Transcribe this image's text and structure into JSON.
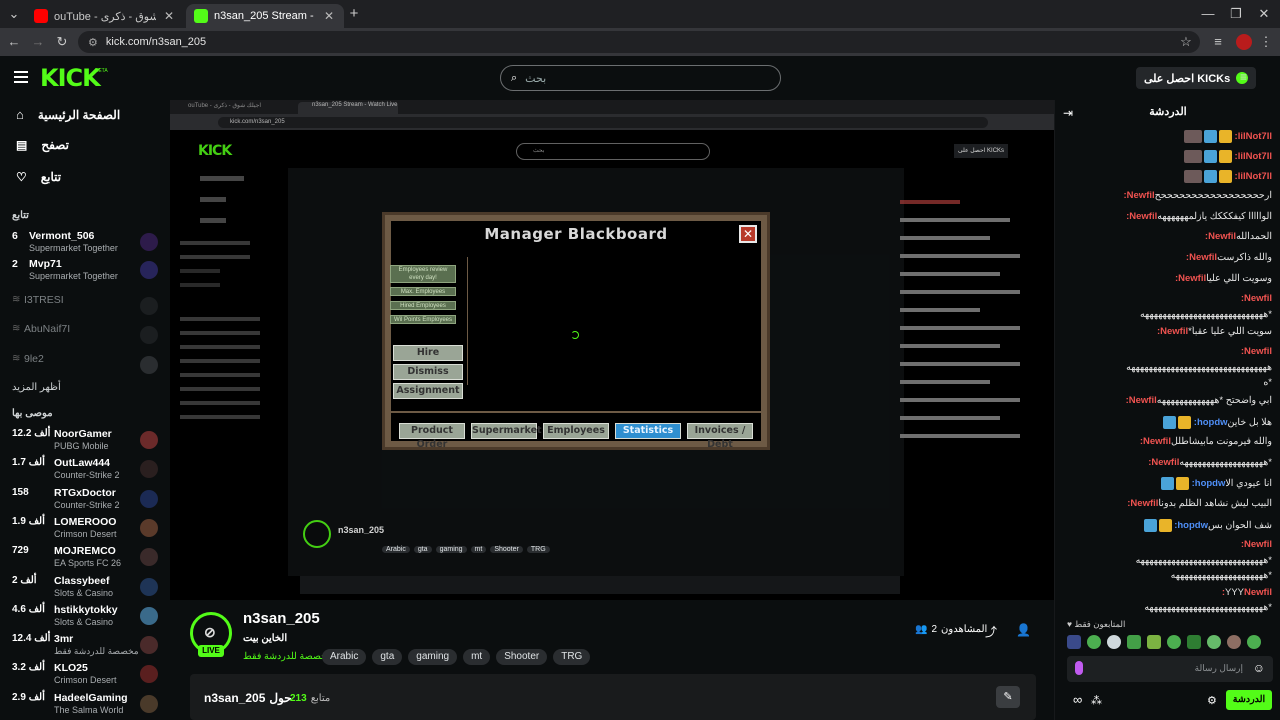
{
  "browser": {
    "tabs": [
      {
        "title": "(ذكرى - اجيلك شوق - YouTube",
        "short": "ouTube - اجيلك شوق - ذكرى"
      },
      {
        "title": "n3san_205 Stream - Watch Live"
      }
    ],
    "url": "kick.com/n3san_205",
    "new_tab": "+"
  },
  "header": {
    "logo": "KICK",
    "logo_beta": "BETA",
    "search_placeholder": "بحث",
    "get_kicks": "احصل على KICKs"
  },
  "sidebar": {
    "nav": [
      {
        "label": "الصفحة الرئيسية",
        "icon": "home-icon"
      },
      {
        "label": "تصفح",
        "icon": "browse-icon"
      },
      {
        "label": "تتابع",
        "icon": "heart-icon"
      }
    ],
    "following_title": "تتابع",
    "following": [
      {
        "count": "6",
        "name": "Vermont_506",
        "sub": "Supermarket Together",
        "live": true
      },
      {
        "count": "2",
        "name": "Mvp71",
        "sub": "Supermarket Together",
        "live": true
      },
      {
        "name": "I3TRESI",
        "live": false
      },
      {
        "name": "AbuNaif7I",
        "live": false
      },
      {
        "name": "9le2",
        "live": false
      }
    ],
    "show_more": "أظهر المزيد",
    "recommended_title": "موصى بها",
    "recommended": [
      {
        "count": "12.2 ألف",
        "name": "NoorGamer",
        "sub": "PUBG Mobile"
      },
      {
        "count": "1.7 ألف",
        "name": "OutLaw444",
        "sub": "Counter-Strike 2"
      },
      {
        "count": "158",
        "name": "RTGxDoctor",
        "sub": "Counter-Strike 2"
      },
      {
        "count": "1.9 ألف",
        "name": "LOMEROOO",
        "sub": "Crimson Desert"
      },
      {
        "count": "729",
        "name": "MOJREMCO",
        "sub": "EA Sports FC 26"
      },
      {
        "count": "2 ألف",
        "name": "Classybeef",
        "sub": "Slots & Casino"
      },
      {
        "count": "4.6 ألف",
        "name": "hstikkytokky",
        "sub": "Slots & Casino"
      },
      {
        "count": "12.4 ألف",
        "name": "3mr",
        "sub": "مخصصة للدردشة فقط"
      },
      {
        "count": "3.2 ألف",
        "name": "KLO25",
        "sub": "Crimson Desert"
      },
      {
        "count": "2.9 ألف",
        "name": "HadeelGaming",
        "sub": "The Salma World"
      }
    ]
  },
  "game": {
    "title": "Manager Blackboard",
    "side_buttons": [
      "Employees review every day!",
      "Max. Employees",
      "Hired Employees",
      "Wil Points Employees"
    ],
    "actions": [
      "Hire",
      "Dismiss",
      "Assignment"
    ],
    "tabs": [
      "Product Order",
      "Supermarket",
      "Employees",
      "Statistics",
      "Invoices / Debt"
    ]
  },
  "stream": {
    "username": "n3san_205",
    "live": "LIVE",
    "title": "الخاين بيت",
    "category": "مخصصة للدردشة فقط",
    "tags": [
      "Arabic",
      "gta",
      "gaming",
      "mt",
      "Shooter",
      "TRG"
    ],
    "viewers_label": "المشاهدون",
    "viewers": "2",
    "about_prefix": "حول",
    "about_name": "n3san_205",
    "followers": "213",
    "followers_label": "متابع"
  },
  "chat": {
    "title": "الدردشة",
    "messages": [
      {
        "user": "lilNot7Il",
        "text": "",
        "badges": true
      },
      {
        "user": "lilNot7Il",
        "text": "",
        "badges": true
      },
      {
        "user": "lilNot7Il",
        "text": "",
        "badges": true
      },
      {
        "user": "Newfil",
        "text": "ارحححححححححححححححححح"
      },
      {
        "user": "Newfil",
        "text": "الوااااا كيفكككك يازلمههههههه"
      },
      {
        "user": "Newfil",
        "text": "الحمدالله"
      },
      {
        "user": "Newfil",
        "text": "والله ذاكرست"
      },
      {
        "user": "Newfil",
        "text": "وسويت اللي عليا"
      },
      {
        "user": "Newfil",
        "text": ""
      },
      {
        "user": "",
        "text": "*ههههههههههههههههههههههههههههه"
      },
      {
        "user": "Newfil",
        "text": "سويت اللي عليا عقباً*"
      },
      {
        "user": "Newfil",
        "text": ""
      },
      {
        "user": "",
        "text": "ههههههههههههههههههههههههههههههههه"
      },
      {
        "user": "",
        "text": "*ه"
      },
      {
        "user": "Newfil",
        "text": "ابي واضحتح *هههههههههههههه"
      },
      {
        "user": "hopdw",
        "text": "هلا بل خاين",
        "badges": true,
        "blue": true
      },
      {
        "user": "Newfil",
        "text": "والله فيرمونت مابيشاطلل"
      },
      {
        "user": "Newfil",
        "text": "*هههههههههههههههههههه"
      },
      {
        "user": "hopdw",
        "text": "انا عيودي الا",
        "badges": true,
        "blue": true
      },
      {
        "user": "Newfil",
        "text": "البيب ليش نشاهد الظلم بدونا"
      },
      {
        "user": "hopdw",
        "text": "شف الحوان بس",
        "badges": true,
        "blue": true
      },
      {
        "user": "Newfil",
        "text": ""
      },
      {
        "user": "",
        "text": "*هههههههههههههههههههههههههههههه"
      },
      {
        "user": "",
        "text": "*هههههههههههههههههههههه"
      },
      {
        "user": "Newfil",
        "text": "YYY"
      },
      {
        "user": "",
        "text": "*هههههههههههههههههههههههههههه"
      }
    ],
    "subs_only": "المتابعون فقط",
    "input_placeholder": "إرسال رسالة",
    "send": "الدردشة"
  },
  "colors": {
    "accent": "#53fc18",
    "bg": "#0b0e0f",
    "chat_user": "#ef5350",
    "chat_user_blue": "#4f8ff7"
  }
}
